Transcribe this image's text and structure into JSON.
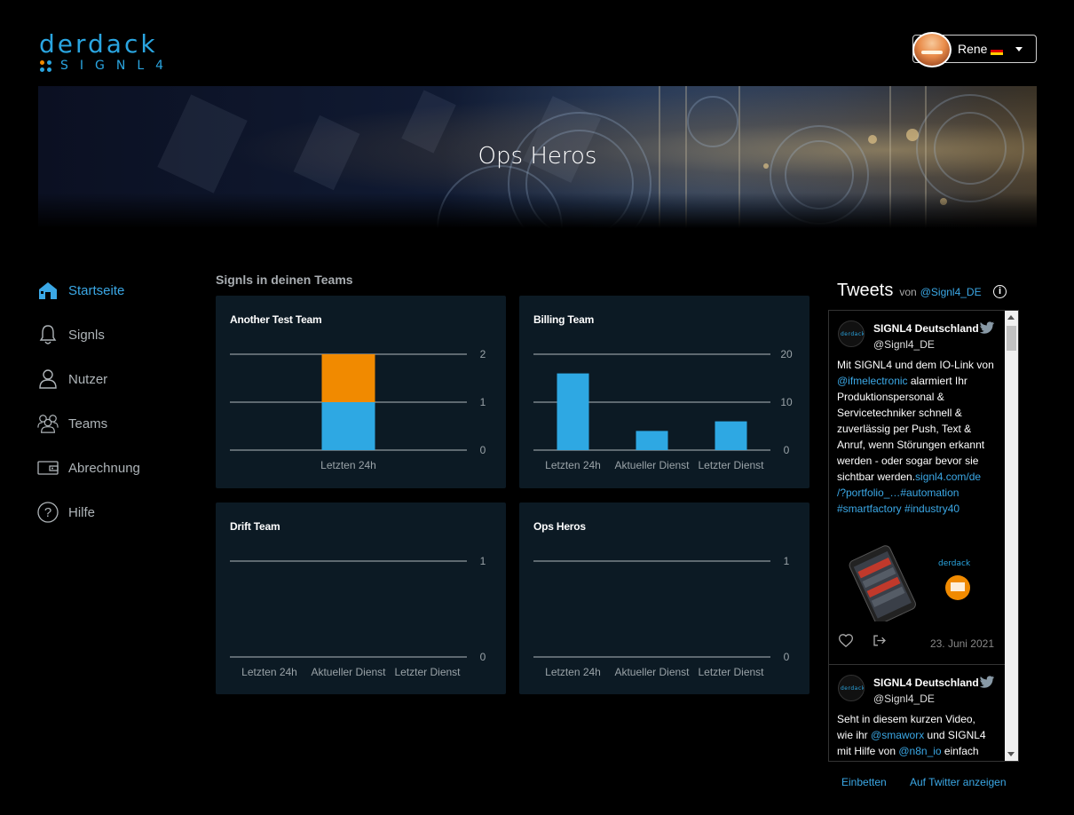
{
  "logo": {
    "top": "DERDACK",
    "bottom": "SIGNL4"
  },
  "user": {
    "name": "Rene",
    "flag_colors": [
      "#000000",
      "#dd0000",
      "#ffce00"
    ]
  },
  "banner": {
    "title": "Ops Heros"
  },
  "sidebar": {
    "items": [
      {
        "label": "Startseite",
        "icon": "home-icon",
        "active": true
      },
      {
        "label": "Signls",
        "icon": "bell-icon",
        "active": false
      },
      {
        "label": "Nutzer",
        "icon": "user-icon",
        "active": false
      },
      {
        "label": "Teams",
        "icon": "team-icon",
        "active": false
      },
      {
        "label": "Abrechnung",
        "icon": "wallet-icon",
        "active": false
      },
      {
        "label": "Hilfe",
        "icon": "help-icon",
        "active": false
      }
    ]
  },
  "main": {
    "section_title": "Signls in deinen Teams"
  },
  "colors": {
    "accent": "#3ba8e6",
    "bar_blue": "#2ea8e3",
    "bar_orange": "#f18a00",
    "card_bg": "#0c1a24"
  },
  "chart_data": [
    {
      "type": "bar",
      "title": "Another Test Team",
      "categories": [
        "Letzten 24h"
      ],
      "series": [
        {
          "values": [
            1
          ],
          "color": "#2ea8e3"
        },
        {
          "values": [
            1
          ],
          "color": "#f18a00"
        }
      ],
      "stacked": true,
      "yticks": [
        0,
        1,
        2
      ],
      "ylim": [
        0,
        2
      ]
    },
    {
      "type": "bar",
      "title": "Billing Team",
      "categories": [
        "Letzten 24h",
        "Aktueller Dienst",
        "Letzter Dienst"
      ],
      "series": [
        {
          "values": [
            16,
            4,
            6
          ],
          "color": "#2ea8e3"
        }
      ],
      "yticks": [
        0,
        10,
        20
      ],
      "ylim": [
        0,
        20
      ]
    },
    {
      "type": "bar",
      "title": "Drift Team",
      "categories": [
        "Letzten 24h",
        "Aktueller Dienst",
        "Letzter Dienst"
      ],
      "series": [
        {
          "values": [
            0,
            0,
            0
          ],
          "color": "#2ea8e3"
        }
      ],
      "yticks": [
        0,
        1
      ],
      "ylim": [
        0,
        1
      ]
    },
    {
      "type": "bar",
      "title": "Ops Heros",
      "categories": [
        "Letzten 24h",
        "Aktueller Dienst",
        "Letzter Dienst"
      ],
      "series": [
        {
          "values": [
            0,
            0,
            0
          ],
          "color": "#2ea8e3"
        }
      ],
      "yticks": [
        0,
        1
      ],
      "ylim": [
        0,
        1
      ]
    }
  ],
  "twitter": {
    "title": "Tweets",
    "von": "von",
    "handle": "@Signl4_DE",
    "info": "i",
    "tweets": [
      {
        "name": "SIGNL4 Deutschland",
        "user": "@Signl4_DE",
        "text_lines": [
          [
            {
              "t": "Mit SIGNL4 und dem IO-Link von"
            }
          ],
          [
            {
              "t": "@ifmelectronic",
              "link": true
            },
            {
              "t": " alarmiert Ihr"
            }
          ],
          [
            {
              "t": "Produktionspersonal &"
            }
          ],
          [
            {
              "t": "Servicetechniker schnell &"
            }
          ],
          [
            {
              "t": "zuverlässig per Push, Text &"
            }
          ],
          [
            {
              "t": "Anruf, wenn Störungen erkannt"
            }
          ],
          [
            {
              "t": "werden - oder sogar bevor sie"
            }
          ],
          [
            {
              "t": "sichtbar werden."
            },
            {
              "t": "signl4.com/de",
              "link": true
            }
          ],
          [
            {
              "t": "/?portfolio_…",
              "link": true
            },
            {
              "t": "#automation",
              "link": true
            }
          ],
          [
            {
              "t": "#smartfactory #industry40",
              "link": true
            }
          ]
        ],
        "date": "23. Juni 2021",
        "image_logo": "DERDACK"
      },
      {
        "name": "SIGNL4 Deutschland",
        "user": "@Signl4_DE",
        "text_lines": [
          [
            {
              "t": "Seht in diesem kurzen Video,"
            }
          ],
          [
            {
              "t": "wie ihr "
            },
            {
              "t": "@smaworx",
              "link": true
            },
            {
              "t": " und SIGNL4"
            }
          ],
          [
            {
              "t": "mit Hilfe von "
            },
            {
              "t": "@n8n_io",
              "link": true
            },
            {
              "t": " einfach"
            }
          ]
        ]
      }
    ],
    "embed_label": "Einbetten",
    "view_label": "Auf Twitter anzeigen"
  }
}
